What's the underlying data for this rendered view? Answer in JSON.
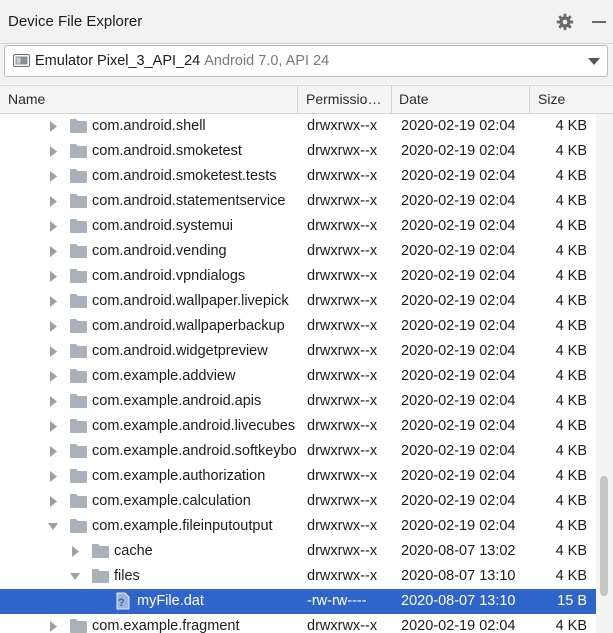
{
  "panel": {
    "title": "Device File Explorer",
    "settings_icon": "gear-icon",
    "hide_icon": "minimize-icon"
  },
  "device": {
    "name": "Emulator Pixel_3_API_24",
    "detail": "Android 7.0, API 24",
    "icon": "device-icon"
  },
  "columns": {
    "name": "Name",
    "permissions": "Permissio…",
    "date": "Date",
    "size": "Size"
  },
  "rows": [
    {
      "name": "com.android.shell",
      "perm": "drwxrwx--x",
      "date": "2020-02-19 02:04",
      "size": "4 KB",
      "depth": 1,
      "kind": "folder",
      "expanded": false
    },
    {
      "name": "com.android.smoketest",
      "perm": "drwxrwx--x",
      "date": "2020-02-19 02:04",
      "size": "4 KB",
      "depth": 1,
      "kind": "folder",
      "expanded": false
    },
    {
      "name": "com.android.smoketest.tests",
      "perm": "drwxrwx--x",
      "date": "2020-02-19 02:04",
      "size": "4 KB",
      "depth": 1,
      "kind": "folder",
      "expanded": false
    },
    {
      "name": "com.android.statementservice",
      "perm": "drwxrwx--x",
      "date": "2020-02-19 02:04",
      "size": "4 KB",
      "depth": 1,
      "kind": "folder",
      "expanded": false
    },
    {
      "name": "com.android.systemui",
      "perm": "drwxrwx--x",
      "date": "2020-02-19 02:04",
      "size": "4 KB",
      "depth": 1,
      "kind": "folder",
      "expanded": false
    },
    {
      "name": "com.android.vending",
      "perm": "drwxrwx--x",
      "date": "2020-02-19 02:04",
      "size": "4 KB",
      "depth": 1,
      "kind": "folder",
      "expanded": false
    },
    {
      "name": "com.android.vpndialogs",
      "perm": "drwxrwx--x",
      "date": "2020-02-19 02:04",
      "size": "4 KB",
      "depth": 1,
      "kind": "folder",
      "expanded": false
    },
    {
      "name": "com.android.wallpaper.livepick",
      "perm": "drwxrwx--x",
      "date": "2020-02-19 02:04",
      "size": "4 KB",
      "depth": 1,
      "kind": "folder",
      "expanded": false
    },
    {
      "name": "com.android.wallpaperbackup",
      "perm": "drwxrwx--x",
      "date": "2020-02-19 02:04",
      "size": "4 KB",
      "depth": 1,
      "kind": "folder",
      "expanded": false
    },
    {
      "name": "com.android.widgetpreview",
      "perm": "drwxrwx--x",
      "date": "2020-02-19 02:04",
      "size": "4 KB",
      "depth": 1,
      "kind": "folder",
      "expanded": false
    },
    {
      "name": "com.example.addview",
      "perm": "drwxrwx--x",
      "date": "2020-02-19 02:04",
      "size": "4 KB",
      "depth": 1,
      "kind": "folder",
      "expanded": false
    },
    {
      "name": "com.example.android.apis",
      "perm": "drwxrwx--x",
      "date": "2020-02-19 02:04",
      "size": "4 KB",
      "depth": 1,
      "kind": "folder",
      "expanded": false
    },
    {
      "name": "com.example.android.livecubes",
      "perm": "drwxrwx--x",
      "date": "2020-02-19 02:04",
      "size": "4 KB",
      "depth": 1,
      "kind": "folder",
      "expanded": false
    },
    {
      "name": "com.example.android.softkeyboard",
      "perm": "drwxrwx--x",
      "date": "2020-02-19 02:04",
      "size": "4 KB",
      "depth": 1,
      "kind": "folder",
      "expanded": false
    },
    {
      "name": "com.example.authorization",
      "perm": "drwxrwx--x",
      "date": "2020-02-19 02:04",
      "size": "4 KB",
      "depth": 1,
      "kind": "folder",
      "expanded": false
    },
    {
      "name": "com.example.calculation",
      "perm": "drwxrwx--x",
      "date": "2020-02-19 02:04",
      "size": "4 KB",
      "depth": 1,
      "kind": "folder",
      "expanded": false
    },
    {
      "name": "com.example.fileinputoutput",
      "perm": "drwxrwx--x",
      "date": "2020-02-19 02:04",
      "size": "4 KB",
      "depth": 1,
      "kind": "folder",
      "expanded": true
    },
    {
      "name": "cache",
      "perm": "drwxrwx--x",
      "date": "2020-08-07 13:02",
      "size": "4 KB",
      "depth": 2,
      "kind": "folder",
      "expanded": false
    },
    {
      "name": "files",
      "perm": "drwxrwx--x",
      "date": "2020-08-07 13:10",
      "size": "4 KB",
      "depth": 2,
      "kind": "folder",
      "expanded": true
    },
    {
      "name": "myFile.dat",
      "perm": "-rw-rw----",
      "date": "2020-08-07 13:10",
      "size": "15 B",
      "depth": 3,
      "kind": "file",
      "selected": true
    },
    {
      "name": "com.example.fragment",
      "perm": "drwxrwx--x",
      "date": "2020-02-19 02:04",
      "size": "4 KB",
      "depth": 1,
      "kind": "folder",
      "expanded": false
    }
  ],
  "colors": {
    "selection": "#2f65ca",
    "folder": "#a9b1ba",
    "header_bg": "#f5f5f5"
  }
}
